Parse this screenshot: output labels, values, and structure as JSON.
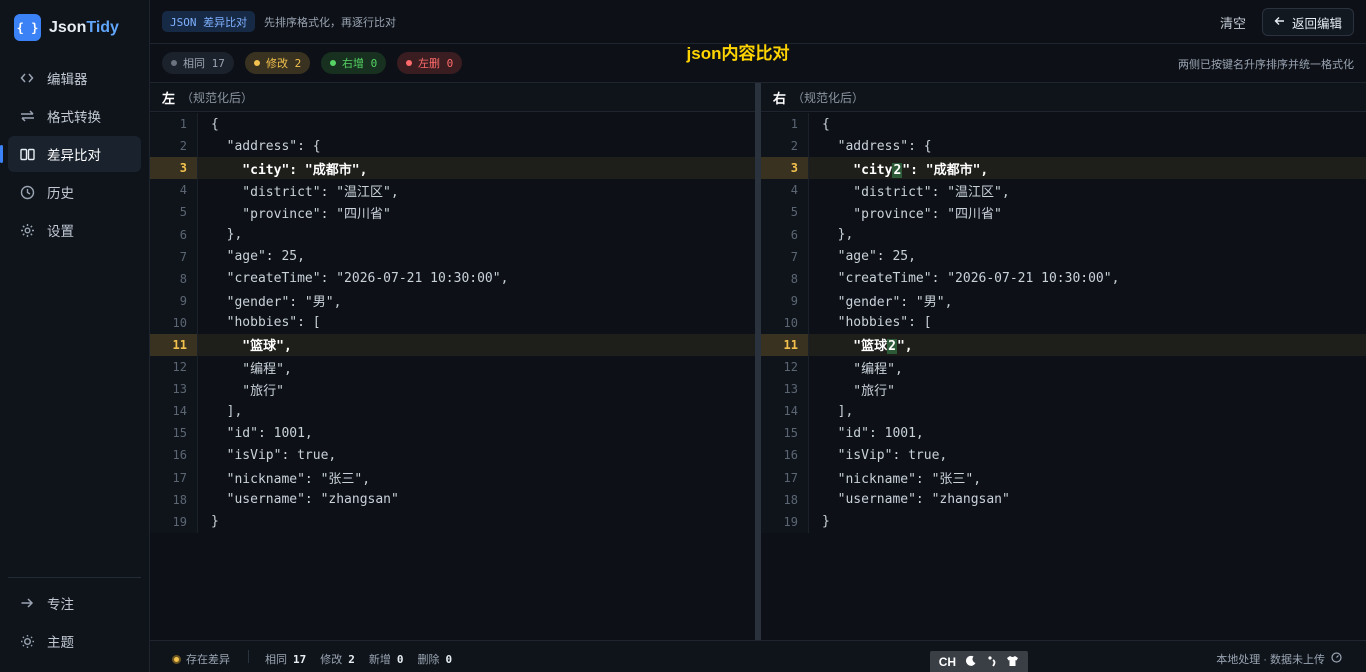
{
  "app": {
    "logo_mark": "{ }",
    "name_part1": "Json",
    "name_part2": "Tidy"
  },
  "sidebar": {
    "items": [
      {
        "label": "编辑器",
        "icon": "code-icon"
      },
      {
        "label": "格式转换",
        "icon": "swap-icon"
      },
      {
        "label": "差异比对",
        "icon": "columns-icon",
        "active": true
      },
      {
        "label": "历史",
        "icon": "clock-icon"
      },
      {
        "label": "设置",
        "icon": "gear-icon"
      }
    ],
    "bottom": [
      {
        "label": "专注",
        "icon": "arrow-right-icon"
      },
      {
        "label": "主题",
        "icon": "sun-icon"
      }
    ]
  },
  "topbar": {
    "mode_badge": "JSON 差异比对",
    "hint": "先排序格式化，再逐行比对",
    "clear_label": "清空",
    "back_label": "返回编辑"
  },
  "stats": {
    "same": "相同 17",
    "modified": "修改 2",
    "added": "右增 0",
    "deleted": "左删 0",
    "title": "json内容比对",
    "note": "两侧已按键名升序排序并统一格式化"
  },
  "left_pane": {
    "side": "左",
    "sub": "（规范化后）",
    "lines": [
      "{",
      "  \"address\": {",
      "    \"city\": \"成都市\",",
      "    \"district\": \"温江区\",",
      "    \"province\": \"四川省\"",
      "  },",
      "  \"age\": 25,",
      "  \"createTime\": \"2026-07-21 10:30:00\",",
      "  \"gender\": \"男\",",
      "  \"hobbies\": [",
      "    \"篮球\",",
      "    \"编程\",",
      "    \"旅行\"",
      "  ],",
      "  \"id\": 1001,",
      "  \"isVip\": true,",
      "  \"nickname\": \"张三\",",
      "  \"username\": \"zhangsan\"",
      "}"
    ],
    "modified_lines": [
      3,
      11
    ]
  },
  "right_pane": {
    "side": "右",
    "sub": "（规范化后）",
    "lines": [
      "{",
      "  \"address\": {",
      "    \"city2\": \"成都市\",",
      "    \"district\": \"温江区\",",
      "    \"province\": \"四川省\"",
      "  },",
      "  \"age\": 25,",
      "  \"createTime\": \"2026-07-21 10:30:00\",",
      "  \"gender\": \"男\",",
      "  \"hobbies\": [",
      "    \"篮球2\",",
      "    \"编程\",",
      "    \"旅行\"",
      "  ],",
      "  \"id\": 1001,",
      "  \"isVip\": true,",
      "  \"nickname\": \"张三\",",
      "  \"username\": \"zhangsan\"",
      "}"
    ],
    "modified_lines": [
      3,
      11
    ],
    "highlights": {
      "3": {
        "before": "    \"city",
        "mark": "2",
        "after": "\": \"成都市\","
      },
      "11": {
        "before": "    \"篮球",
        "mark": "2",
        "after": "\","
      }
    }
  },
  "footer": {
    "status": "存在差异",
    "same_label": "相同",
    "same_value": "17",
    "mod_label": "修改",
    "mod_value": "2",
    "add_label": "新增",
    "add_value": "0",
    "del_label": "删除",
    "del_value": "0",
    "right_text": "本地处理 · 数据未上传",
    "ime": "CH"
  },
  "colors": {
    "accent": "#3b82f6",
    "modified": "#f2c14e",
    "added": "#56d364",
    "deleted": "#ff6b6b",
    "title": "#ffd400"
  }
}
